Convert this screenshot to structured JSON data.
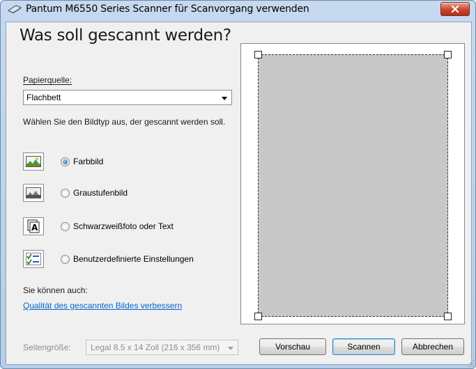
{
  "window": {
    "title": "Pantum M6550 Series Scanner für Scanvorgang verwenden",
    "close_icon": "close-icon",
    "accent": "#c9452e"
  },
  "main": {
    "heading": "Was soll gescannt werden?",
    "source_label": "Papierquelle:",
    "source_value": "Flachbett",
    "type_prompt": "Wählen Sie den Bildtyp aus, der gescannt werden soll.",
    "image_types": [
      {
        "label": "Farbbild",
        "icon": "color-photo-icon",
        "selected": true
      },
      {
        "label": "Graustufenbild",
        "icon": "grayscale-photo-icon",
        "selected": false
      },
      {
        "label": "Schwarzweißfoto oder Text",
        "icon": "black-white-text-icon",
        "selected": false
      },
      {
        "label": "Benutzerdefinierte Einstellungen",
        "icon": "custom-settings-icon",
        "selected": false
      }
    ],
    "also_label": "Sie können auch:",
    "quality_link": "Qualität des gescannten Bildes verbessern"
  },
  "footer": {
    "page_size_label": "Seitengröße:",
    "page_size_value": "Legal 8.5 x 14 Zoll (216 x 356 mm)",
    "preview_button": "Vorschau",
    "scan_button": "Scannen",
    "cancel_button": "Abbrechen"
  }
}
